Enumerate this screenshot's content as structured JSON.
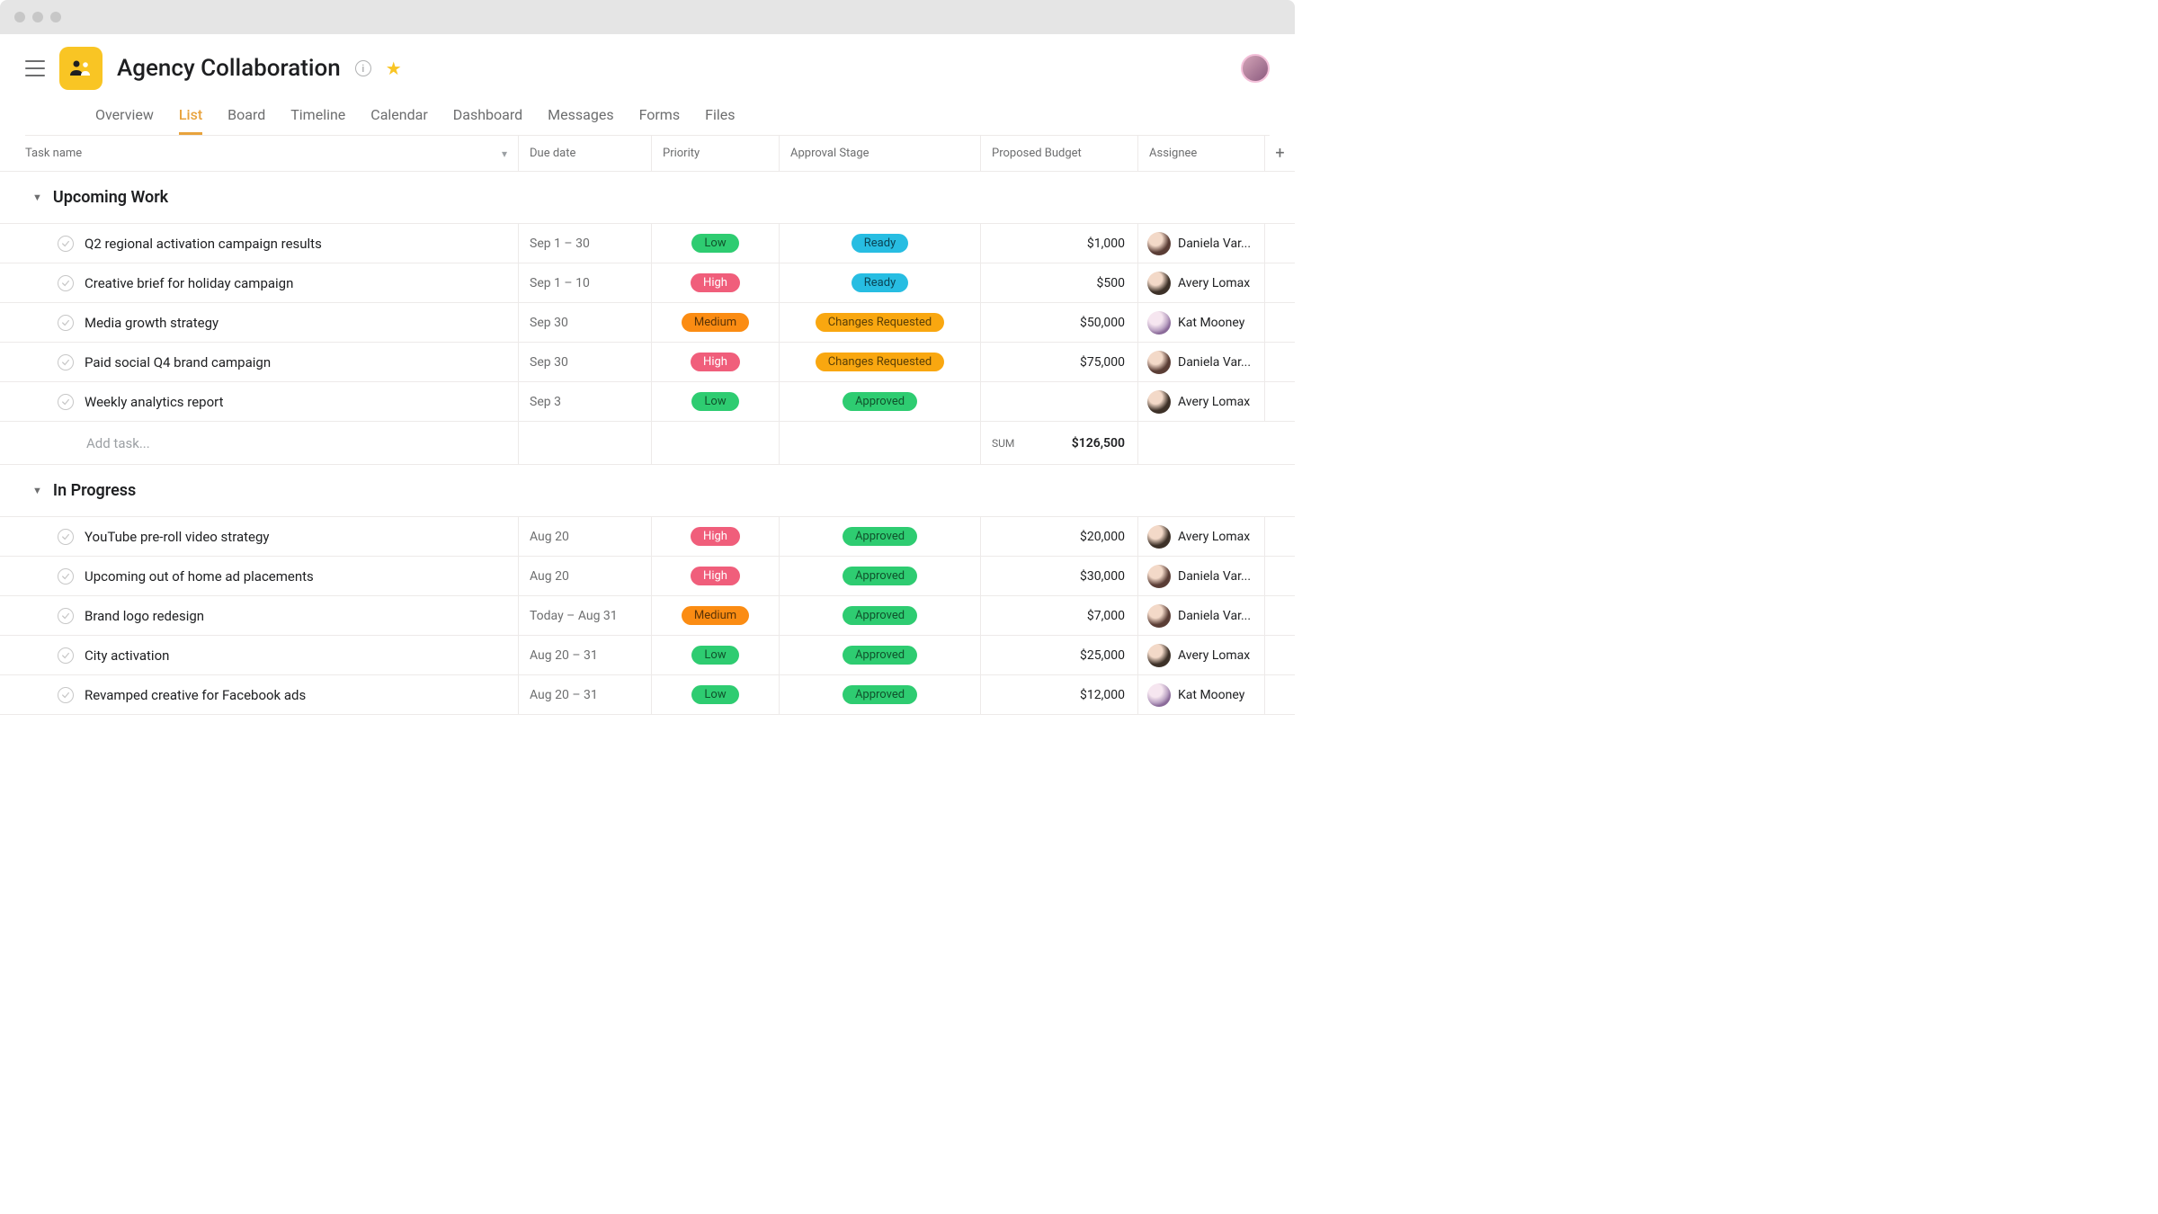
{
  "project": {
    "title": "Agency Collaboration"
  },
  "tabs": [
    "Overview",
    "List",
    "Board",
    "Timeline",
    "Calendar",
    "Dashboard",
    "Messages",
    "Forms",
    "Files"
  ],
  "activeTab": "List",
  "columns": {
    "task": "Task name",
    "due": "Due date",
    "priority": "Priority",
    "approval": "Approval Stage",
    "budget": "Proposed Budget",
    "assignee": "Assignee"
  },
  "sections": [
    {
      "name": "Upcoming Work",
      "tasks": [
        {
          "name": "Q2 regional activation campaign results",
          "due": "Sep 1 – 30",
          "priority": "Low",
          "approval": "Ready",
          "budget": "$1,000",
          "assignee": "Daniela Var...",
          "avatar": "daniela"
        },
        {
          "name": "Creative brief for holiday campaign",
          "due": "Sep 1 – 10",
          "priority": "High",
          "approval": "Ready",
          "budget": "$500",
          "assignee": "Avery Lomax",
          "avatar": "avery"
        },
        {
          "name": "Media growth strategy",
          "due": "Sep 30",
          "priority": "Medium",
          "approval": "Changes Requested",
          "budget": "$50,000",
          "assignee": "Kat Mooney",
          "avatar": "kat"
        },
        {
          "name": "Paid social Q4 brand campaign",
          "due": "Sep 30",
          "priority": "High",
          "approval": "Changes Requested",
          "budget": "$75,000",
          "assignee": "Daniela Var...",
          "avatar": "daniela"
        },
        {
          "name": "Weekly analytics report",
          "due": "Sep 3",
          "priority": "Low",
          "approval": "Approved",
          "budget": "",
          "assignee": "Avery Lomax",
          "avatar": "avery"
        }
      ],
      "addTaskPlaceholder": "Add task...",
      "sumLabel": "SUM",
      "sumValue": "$126,500"
    },
    {
      "name": "In Progress",
      "tasks": [
        {
          "name": "YouTube pre-roll video strategy",
          "due": "Aug 20",
          "priority": "High",
          "approval": "Approved",
          "budget": "$20,000",
          "assignee": "Avery Lomax",
          "avatar": "avery"
        },
        {
          "name": "Upcoming out of home ad placements",
          "due": "Aug 20",
          "priority": "High",
          "approval": "Approved",
          "budget": "$30,000",
          "assignee": "Daniela Var...",
          "avatar": "daniela"
        },
        {
          "name": "Brand logo redesign",
          "due": "Today – Aug 31",
          "priority": "Medium",
          "approval": "Approved",
          "budget": "$7,000",
          "assignee": "Daniela Var...",
          "avatar": "daniela"
        },
        {
          "name": "City activation",
          "due": "Aug 20 – 31",
          "priority": "Low",
          "approval": "Approved",
          "budget": "$25,000",
          "assignee": "Avery Lomax",
          "avatar": "avery"
        },
        {
          "name": "Revamped creative for Facebook ads",
          "due": "Aug 20 – 31",
          "priority": "Low",
          "approval": "Approved",
          "budget": "$12,000",
          "assignee": "Kat Mooney",
          "avatar": "kat"
        }
      ]
    }
  ],
  "priorityMap": {
    "Low": "pill-low",
    "High": "pill-high",
    "Medium": "pill-medium"
  },
  "approvalMap": {
    "Ready": "pill-ready",
    "Changes Requested": "pill-changes",
    "Approved": "pill-approved"
  },
  "avatarMap": {
    "daniela": "av-daniela",
    "avery": "av-avery",
    "kat": "av-kat"
  }
}
